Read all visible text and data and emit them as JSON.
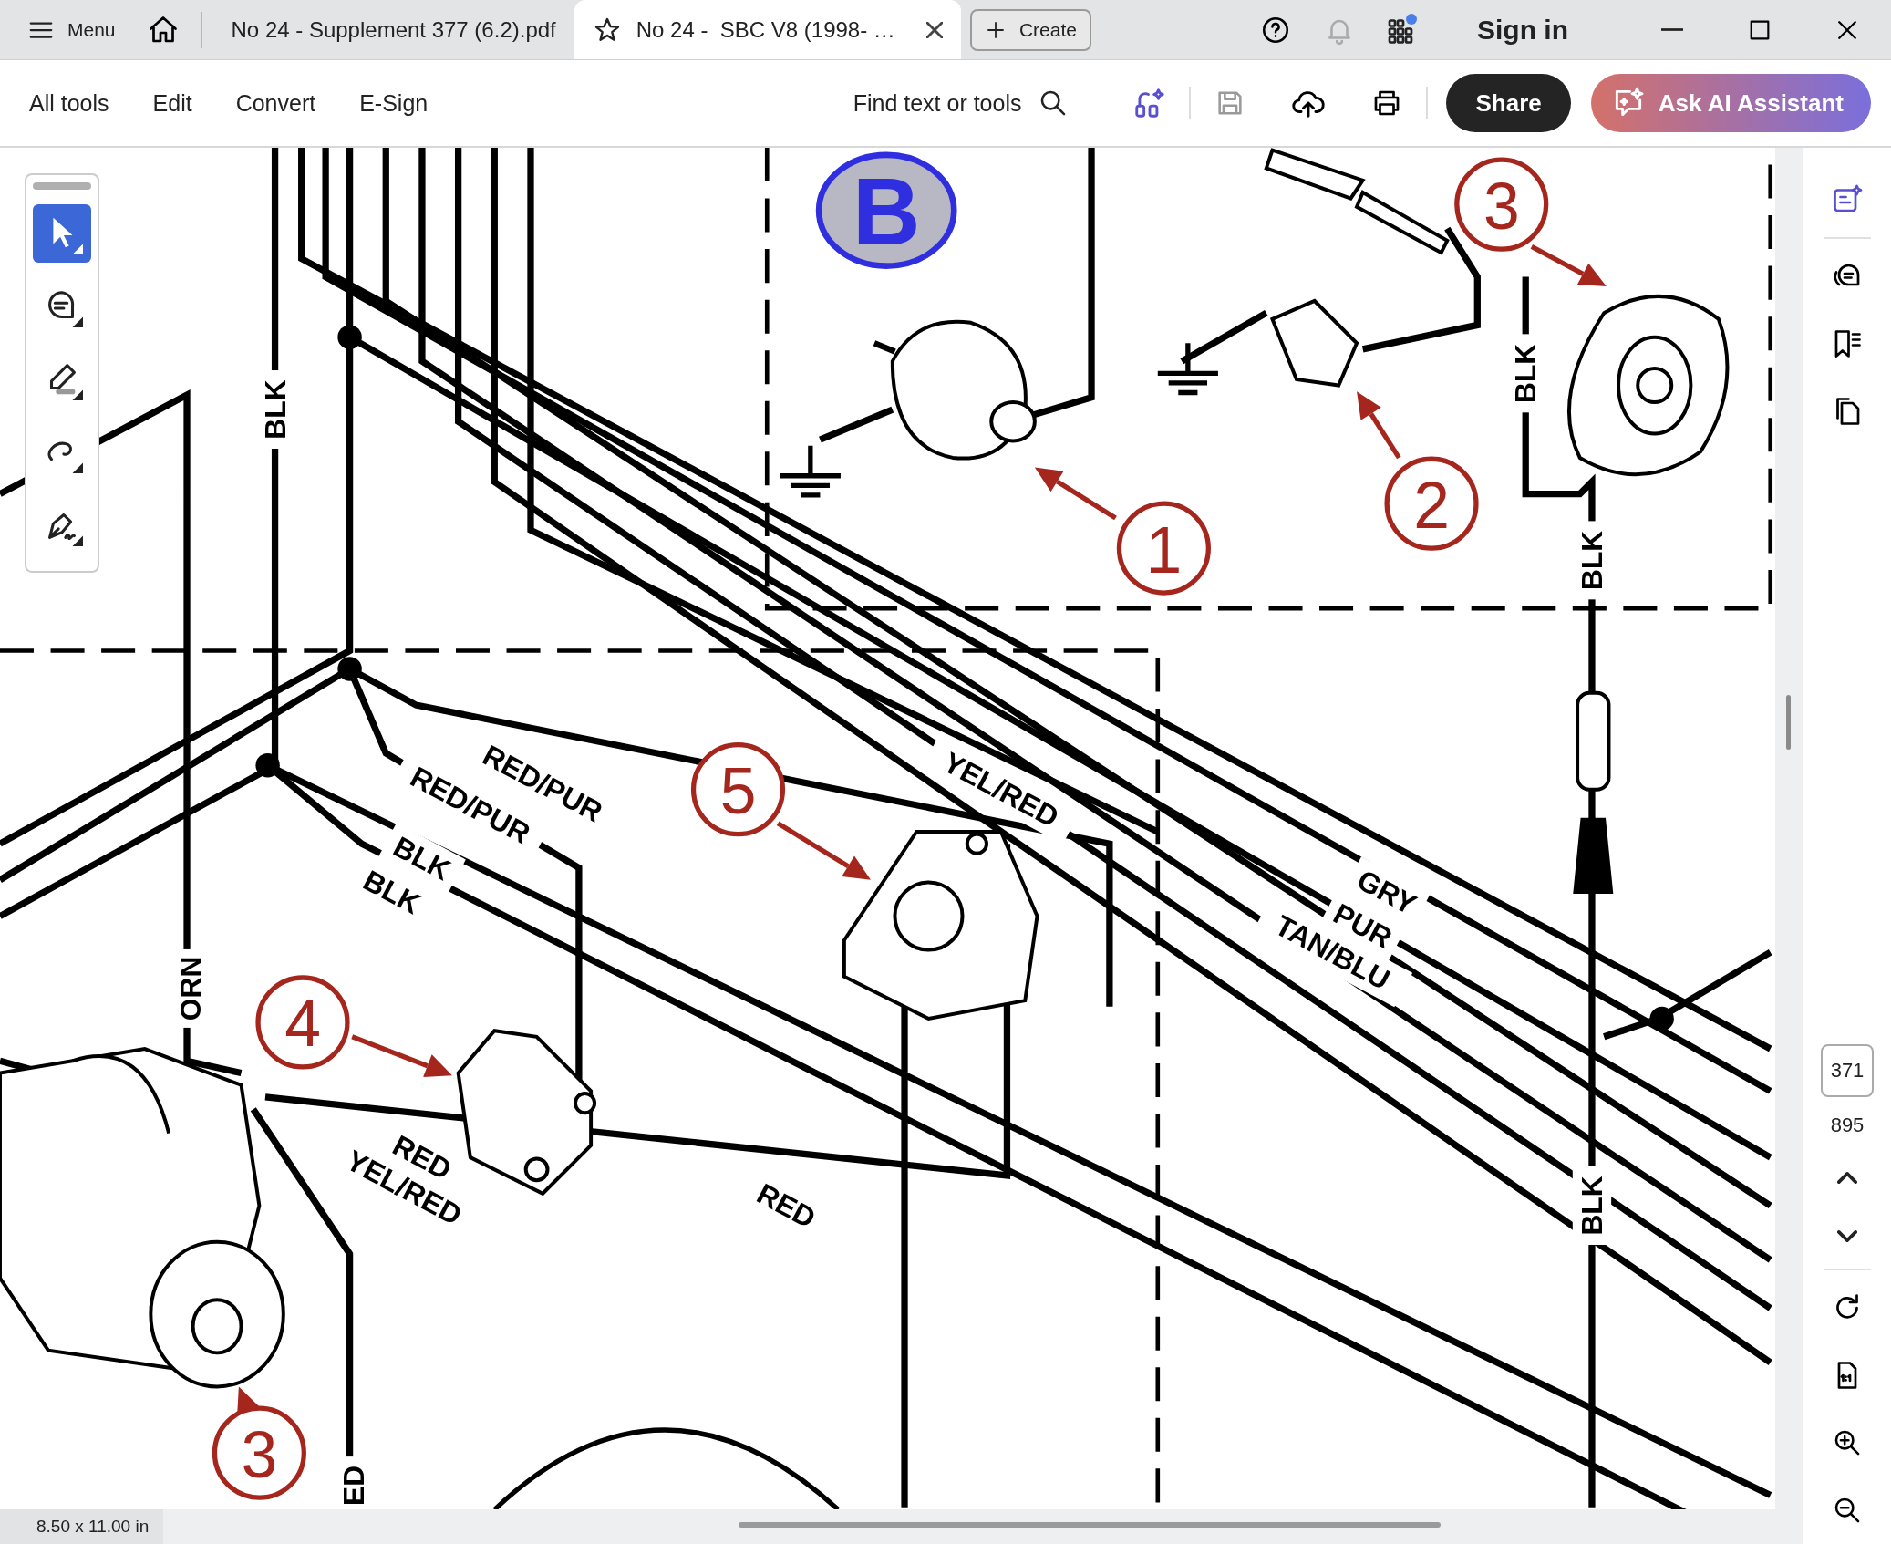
{
  "title_bar": {
    "menu": "Menu",
    "tabs": [
      {
        "label": "No 24 - Supplement 377 (6.2).pdf",
        "selected": false
      },
      {
        "label": "No 24 -  SBC V8 (1998- …",
        "selected": true
      }
    ],
    "create": "Create",
    "sign_in": "Sign in"
  },
  "toolbar": {
    "menus": [
      "All tools",
      "Edit",
      "Convert",
      "E-Sign"
    ],
    "search": "Find text or tools",
    "share": "Share",
    "ai_button": "Ask AI Assistant"
  },
  "tools": [
    {
      "kind": "select",
      "selected": true
    },
    {
      "kind": "comment",
      "selected": false
    },
    {
      "kind": "highlight",
      "selected": false
    },
    {
      "kind": "draw",
      "selected": false
    },
    {
      "kind": "sign",
      "selected": false
    }
  ],
  "document": {
    "section_mark": "B",
    "callouts": [
      "1",
      "2",
      "3",
      "5",
      "4",
      "3"
    ],
    "wire_labels": [
      "BLK",
      "RED/PUR",
      "RED/PUR",
      "BLK",
      "BLK",
      "YEL/RED",
      "GRY",
      "PUR",
      "TAN/BLU",
      "BLK",
      "BLK",
      "BLK",
      "ORN",
      "RED",
      "YEL/RED",
      "RED",
      "ED"
    ]
  },
  "page_nav": {
    "current": "371",
    "total": "895"
  },
  "status_bar": {
    "page_size": "8.50 x 11.00 in"
  }
}
